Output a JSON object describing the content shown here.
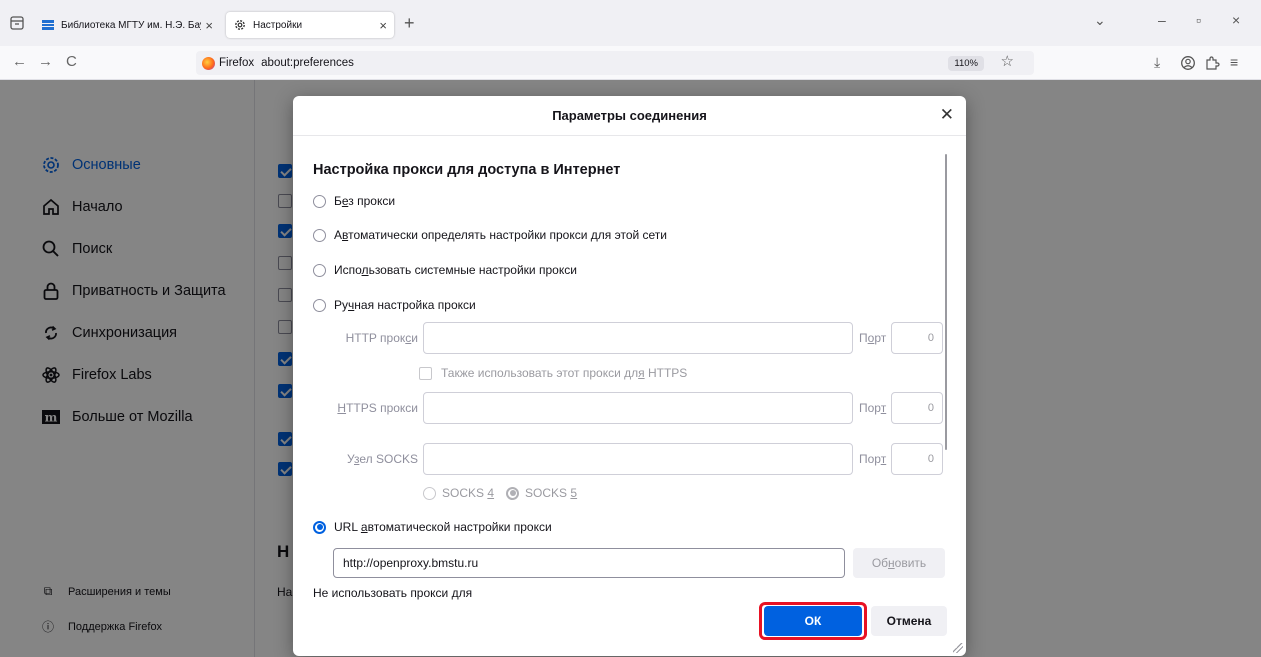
{
  "browser": {
    "tabs": [
      {
        "title": "Библиотека МГТУ им. Н.Э. Бау",
        "close": "×"
      },
      {
        "title": "Настройки",
        "close": "×"
      }
    ],
    "new_tab": "+",
    "window_controls": {
      "dropdown": "⌄",
      "minimize": "–",
      "restore": "▫",
      "close": "×"
    },
    "nav": {
      "back": "←",
      "forward": "→",
      "reload": "C"
    },
    "url_identity": "Firefox",
    "url": "about:preferences",
    "zoom": "110%"
  },
  "sidebar": {
    "categories": [
      {
        "label": "Основные",
        "icon": "gear-icon",
        "active": true
      },
      {
        "label": "Начало",
        "icon": "home-icon"
      },
      {
        "label": "Поиск",
        "icon": "search-icon"
      },
      {
        "label": "Приватность и Защита",
        "icon": "lock-icon"
      },
      {
        "label": "Синхронизация",
        "icon": "sync-icon"
      },
      {
        "label": "Firefox Labs",
        "icon": "labs-icon"
      },
      {
        "label": "Больше от Mozilla",
        "icon": "mozilla-icon"
      }
    ],
    "footer": [
      {
        "label": "Расширения и темы",
        "icon": "puzzle-icon"
      },
      {
        "label": "Поддержка Firefox",
        "icon": "help-icon"
      }
    ]
  },
  "background": {
    "heading_fragment": "Н",
    "text_fragment": "На",
    "checkboxes": [
      true,
      false,
      true,
      false,
      false,
      false,
      true,
      true,
      true,
      true
    ]
  },
  "dialog": {
    "title": "Параметры соединения",
    "section_heading": "Настройка прокси для доступа в Интернет",
    "radio_options": [
      {
        "pre": "Б",
        "key": "е",
        "post": "з прокси",
        "selected": false
      },
      {
        "pre": "А",
        "key": "в",
        "post": "томатически определять настройки прокси для этой сети",
        "selected": false
      },
      {
        "pre": "Испо",
        "key": "л",
        "post": "ьзовать системные настройки прокси",
        "selected": false
      },
      {
        "pre": "Ру",
        "key": "ч",
        "post": "ная настройка прокси",
        "selected": false
      }
    ],
    "http_proxy": {
      "label_pre": "HTTP прок",
      "label_key": "с",
      "label_post": "и",
      "value": "",
      "port_label_pre": "П",
      "port_label_key": "о",
      "port_label_post": "рт",
      "port": "0"
    },
    "also_https": {
      "pre": "Также использовать этот прокси дл",
      "key": "я",
      "post": " HTTPS",
      "checked": false
    },
    "https_proxy": {
      "label_pre": "",
      "label_key": "H",
      "label_post": "TTPS прокси",
      "value": "",
      "port_label_pre": "Пор",
      "port_label_key": "т",
      "port_label_post": "",
      "port": "0"
    },
    "socks_host": {
      "label_pre": "У",
      "label_key": "з",
      "label_post": "ел SOCKS",
      "value": "",
      "port_label_pre": "Пор",
      "port_label_key": "т",
      "port_label_post": "",
      "port": "0"
    },
    "socks_versions": [
      {
        "pre": "SOCKS ",
        "key": "4",
        "selected": false
      },
      {
        "pre": "SOCKS ",
        "key": "5",
        "selected": true
      }
    ],
    "auto_url": {
      "pre": "URL ",
      "key": "а",
      "post": "втоматической настройки прокси",
      "selected": true,
      "value": "http://openproxy.bmstu.ru"
    },
    "update_button": {
      "pre": "Об",
      "key": "н",
      "post": "овить"
    },
    "no_proxy_label": "Не использовать прокси для",
    "ok_label": "ОК",
    "cancel_label": "Отмена"
  },
  "colors": {
    "accent": "#0061e0",
    "highlight_outline": "#e81224",
    "tab_strip": "#f0f0f4"
  }
}
